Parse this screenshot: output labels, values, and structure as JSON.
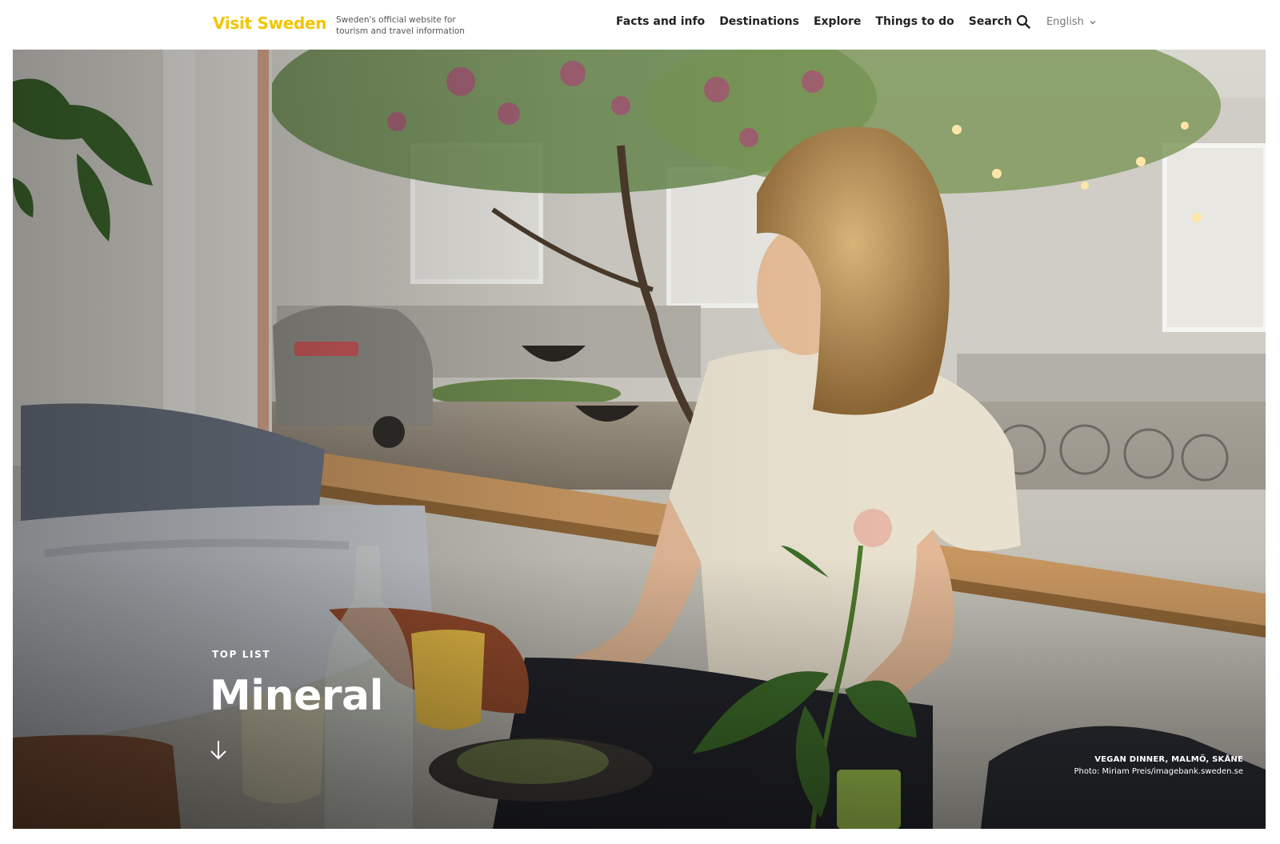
{
  "header": {
    "logo": "Visit Sweden",
    "tagline": "Sweden's official website for tourism and travel information",
    "nav": [
      {
        "label": "Facts and info"
      },
      {
        "label": "Destinations"
      },
      {
        "label": "Explore"
      },
      {
        "label": "Things to do"
      }
    ],
    "search_label": "Search",
    "language": "English"
  },
  "hero": {
    "eyebrow": "TOP LIST",
    "title": "Mineral",
    "caption_title": "VEGAN DINNER, MALMÖ, SKÅNE",
    "caption_credit": "Photo: Miriam Preis/imagebank.sweden.se"
  },
  "colors": {
    "brand_yellow": "#f2c500",
    "text_dark": "#222222",
    "text_muted": "#777777"
  }
}
